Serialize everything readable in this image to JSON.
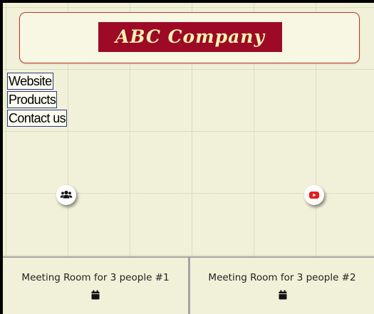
{
  "header": {
    "company_name": "ABC Company",
    "title_bg": "#9d0a26",
    "title_color": "#f8f3b2"
  },
  "nav": {
    "links": [
      "Website",
      "Products",
      "Contact us"
    ]
  },
  "icons": {
    "people": "users-icon",
    "video": "youtube-icon"
  },
  "rooms": [
    {
      "name": "Meeting Room for 3 people #1",
      "icon": "calendar-icon"
    },
    {
      "name": "Meeting Room for 3 people #2",
      "icon": "calendar-icon"
    }
  ]
}
